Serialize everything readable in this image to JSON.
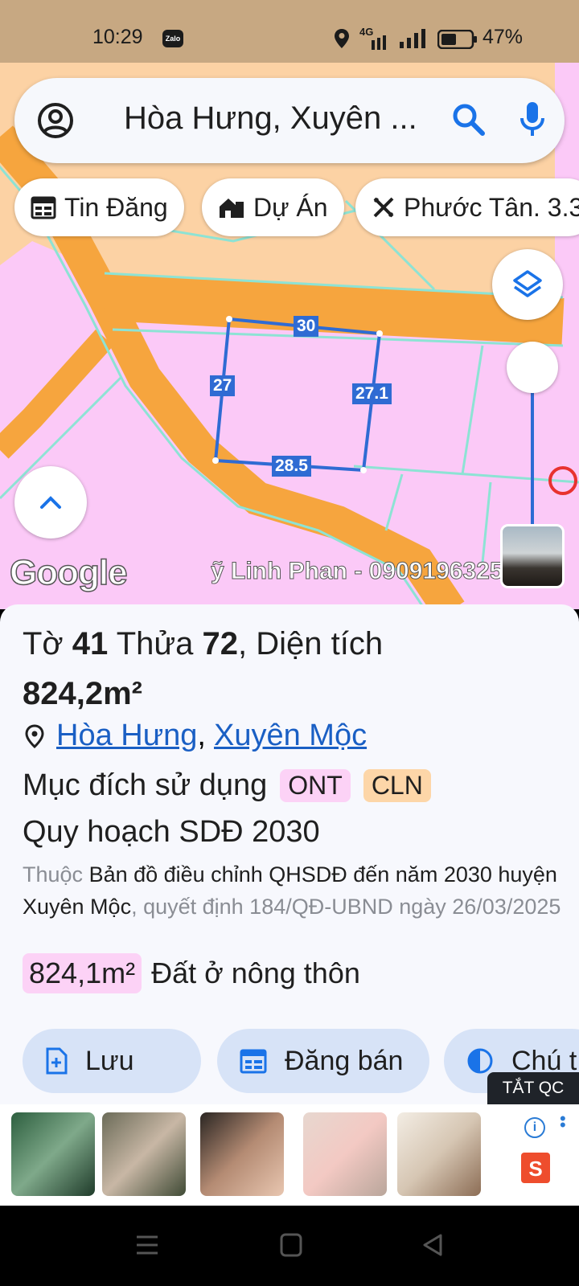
{
  "status": {
    "time": "10:29",
    "app_badge": "Zalo",
    "network": "4G",
    "battery": "47%"
  },
  "search": {
    "query": "Hòa Hưng, Xuyên ..."
  },
  "chips": [
    {
      "label": "Tin Đăng",
      "icon": "listing-icon"
    },
    {
      "label": "Dự Án",
      "icon": "project-building-icon"
    },
    {
      "label": "Phước Tân. 3.3",
      "icon": "ruler-pencil-icon"
    }
  ],
  "map": {
    "google_logo": "Google",
    "watermark": "ỹ Linh Phan - 0909196325",
    "edges": [
      "30",
      "27",
      "27.1",
      "28.5"
    ]
  },
  "parcel": {
    "to_label": "Tờ",
    "to_value": "41",
    "thua_label": "Thửa",
    "thua_value": "72",
    "dien_tich_label": ", Diện tích",
    "area": "824,2m²",
    "location_ward": "Hòa Hưng",
    "location_sep": ",",
    "location_district": "Xuyên Mộc",
    "purpose_label": "Mục đích sử dụng",
    "tags": [
      {
        "code": "ONT",
        "color": "#fcd2f6"
      },
      {
        "code": "CLN",
        "color": "#fdd6a8"
      }
    ],
    "plan_title": "Quy hoạch SDĐ 2030",
    "desc_prefix": "Thuộc",
    "desc_main": "Bản đồ điều chỉnh QHSDĐ đến năm 2030 huyện Xuyên Mộc",
    "desc_suffix": ", quyết định 184/QĐ-UBND ngày 26/03/2025",
    "land_area": "824,1m²",
    "land_type": "Đất ở nông thôn"
  },
  "actions": [
    {
      "label": "Lưu",
      "icon": "save-doc-icon"
    },
    {
      "label": "Đăng bán",
      "icon": "post-sale-icon"
    },
    {
      "label": "Chú t",
      "icon": "contrast-icon"
    }
  ],
  "ad": {
    "close_label": "TẮT QC",
    "shop_letter": "S"
  }
}
